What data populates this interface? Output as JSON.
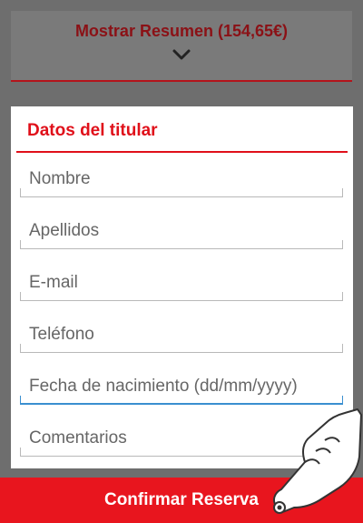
{
  "summary": {
    "label": "Mostrar Resumen (154,65€)",
    "chevron_icon": "chevron-down-icon"
  },
  "form": {
    "title": "Datos del titular",
    "fields": [
      {
        "name": "nombre",
        "placeholder": "Nombre",
        "value": ""
      },
      {
        "name": "apellidos",
        "placeholder": "Apellidos",
        "value": ""
      },
      {
        "name": "email",
        "placeholder": "E-mail",
        "value": ""
      },
      {
        "name": "telefono",
        "placeholder": "Teléfono",
        "value": ""
      },
      {
        "name": "fecha-nacimiento",
        "placeholder": "Fecha de nacimiento (dd/mm/yyyy)",
        "value": "",
        "focused": true
      },
      {
        "name": "comentarios",
        "placeholder": "Comentarios",
        "value": ""
      }
    ]
  },
  "confirm": {
    "label": "Confirmar Reserva",
    "hand_icon": "tap-hand-icon"
  },
  "colors": {
    "accent_red": "#e8151e",
    "dark_red": "#8b1116",
    "focus_blue": "#3a8fd0",
    "overlay_grey": "#6e6e6e"
  }
}
